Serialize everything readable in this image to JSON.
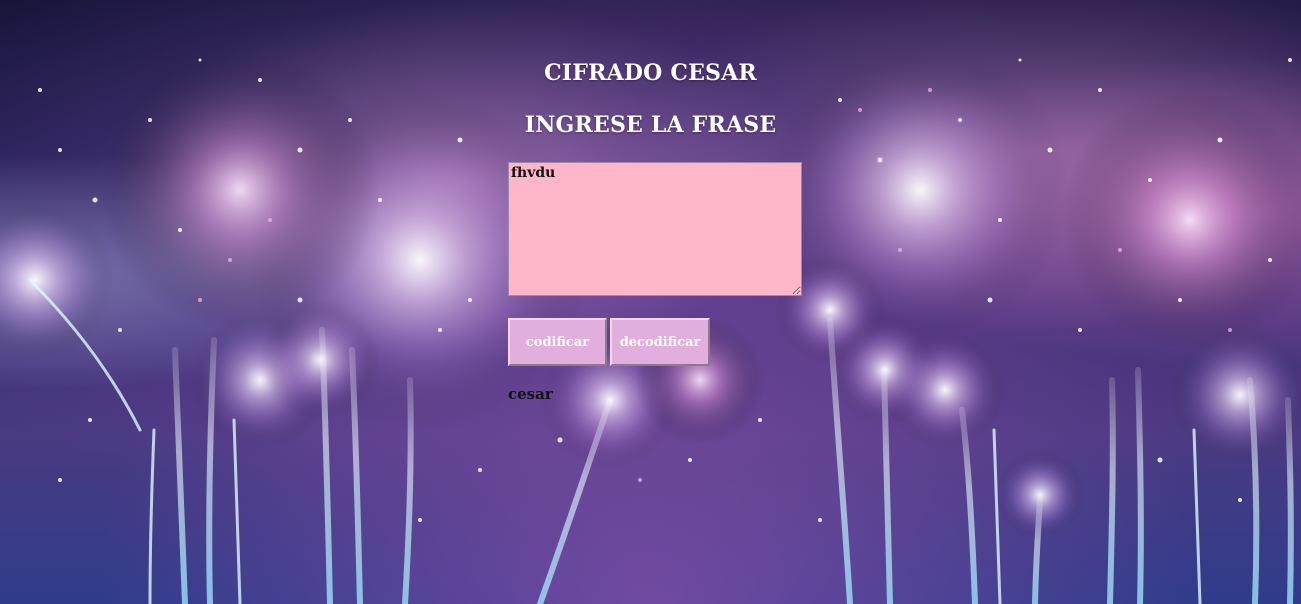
{
  "header": {
    "title": "CIFRADO CESAR",
    "subtitle": "INGRESE LA FRASE"
  },
  "form": {
    "phrase_value": "fhvdu",
    "encode_label": "codificar",
    "decode_label": "decodificar"
  },
  "output": {
    "result_text": "cesar"
  },
  "colors": {
    "textarea_bg": "#ffb6c8",
    "button_bg": "#e2aedd",
    "heading_text": "#ffffff",
    "result_text": "#111111"
  }
}
